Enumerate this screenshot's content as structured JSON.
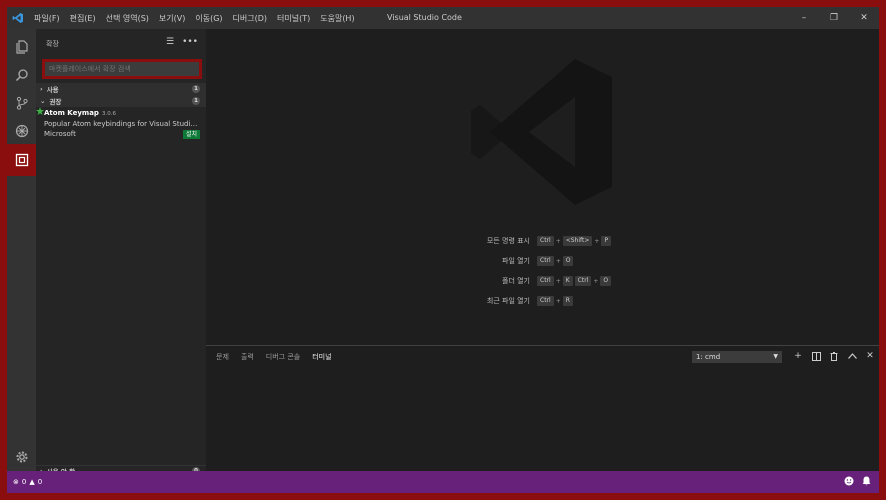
{
  "window": {
    "title": "Visual Studio Code",
    "menu": [
      "파일(F)",
      "편집(E)",
      "선택 영역(S)",
      "보기(V)",
      "이동(G)",
      "디버그(D)",
      "터미널(T)",
      "도움말(H)"
    ]
  },
  "sidebar": {
    "title": "확장",
    "search_placeholder": "마켓플레이스에서 확장 검색",
    "sections": {
      "installed": {
        "label": "사용",
        "count": "1"
      },
      "recommended": {
        "label": "권장",
        "count": "1"
      },
      "disabled": {
        "label": "사용 안 함",
        "count": "0"
      }
    },
    "extension": {
      "name": "Atom Keymap",
      "version": "3.0.6",
      "description": "Popular Atom keybindings for Visual Studio C...",
      "publisher": "Microsoft",
      "install_label": "설치"
    }
  },
  "editor": {
    "shortcuts": [
      {
        "label": "모든 명령 표시",
        "keys": [
          "Ctrl",
          "+",
          "<Shift>",
          "+",
          "P"
        ]
      },
      {
        "label": "파일 열기",
        "keys": [
          "Ctrl",
          "+",
          "O"
        ]
      },
      {
        "label": "폴더 열기",
        "keys": [
          "Ctrl",
          "+",
          "K",
          "Ctrl",
          "+",
          "O"
        ]
      },
      {
        "label": "최근 파일 열기",
        "keys": [
          "Ctrl",
          "+",
          "R"
        ]
      }
    ]
  },
  "panel": {
    "tabs": [
      "문제",
      "출력",
      "디버그 콘솔",
      "터미널"
    ],
    "active_tab": "터미널",
    "terminal_select": "1: cmd"
  },
  "statusbar": {
    "errors": "0",
    "warnings": "0"
  },
  "colors": {
    "accent": "#8b0e0e",
    "statusbar": "#68217a",
    "install": "#0e7a38"
  }
}
